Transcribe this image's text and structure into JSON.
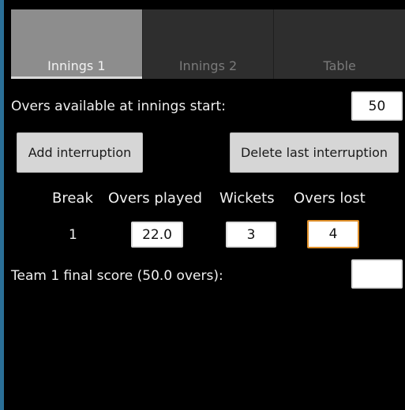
{
  "tabs": [
    {
      "label": "Innings 1",
      "active": true
    },
    {
      "label": "Innings 2",
      "active": false
    },
    {
      "label": "Table",
      "active": false
    }
  ],
  "overs_start": {
    "label": "Overs available at innings start:",
    "value": "50"
  },
  "buttons": {
    "add_interruption": "Add interruption",
    "delete_last_interruption": "Delete last interruption"
  },
  "interruptions": {
    "headers": {
      "break": "Break",
      "overs_played": "Overs played",
      "wickets": "Wickets",
      "overs_lost": "Overs lost"
    },
    "rows": [
      {
        "break": "1",
        "overs_played": "22.0",
        "wickets": "3",
        "overs_lost": "4"
      }
    ]
  },
  "final_score": {
    "label": "Team 1 final score (50.0 overs):",
    "value": ""
  },
  "colors": {
    "background": "#000000",
    "tab_active": "#8d8d8d",
    "tab_inactive": "#2e2e2e",
    "button": "#d6d6d6",
    "focus_border": "#e0902a"
  }
}
